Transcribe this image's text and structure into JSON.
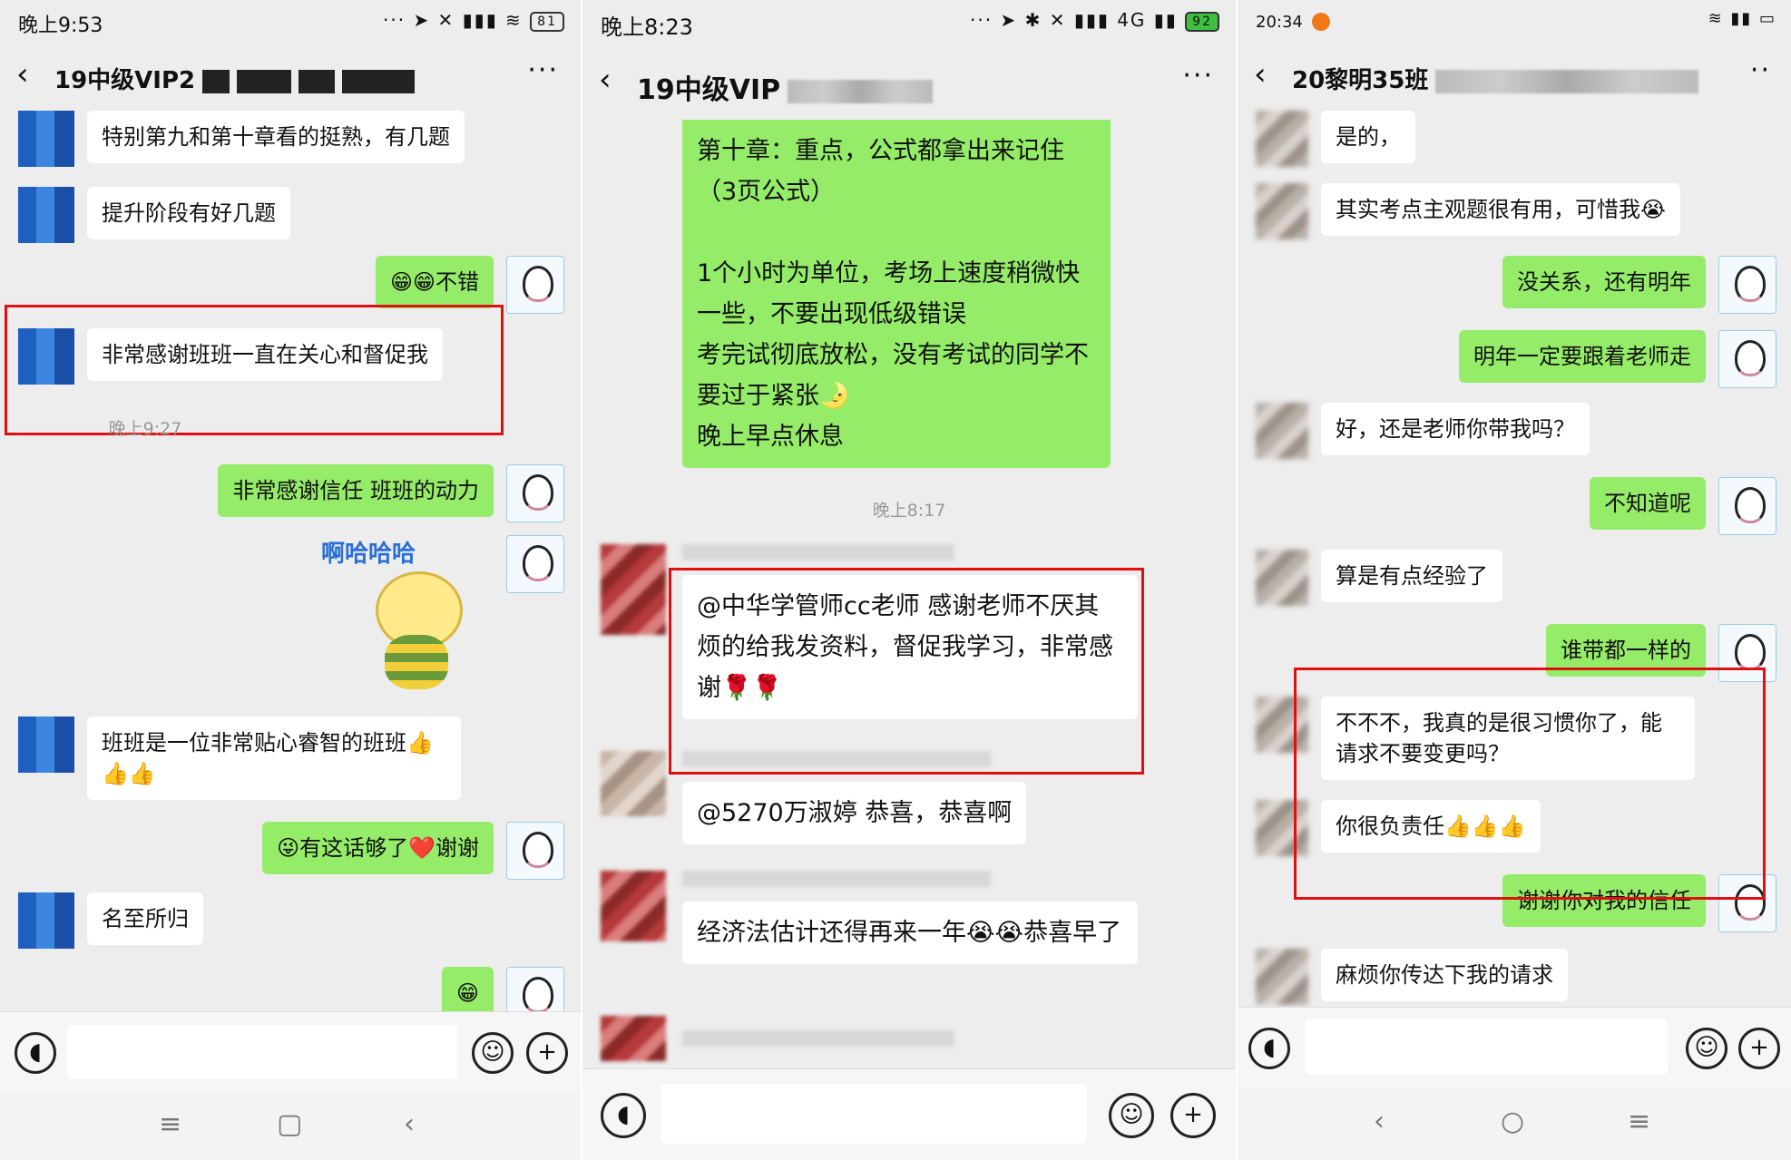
{
  "p1": {
    "status_time": "晚上9:53",
    "battery": "81",
    "title": "19中级VIP2",
    "messages": [
      "特别第九和第十章看的挺熟，有几题",
      "提升阶段有好几题",
      "😁😁不错",
      "非常感谢班班一直在关心和督促我",
      "非常感谢信任 班班的动力",
      "班班是一位非常贴心睿智的班班👍👍👍",
      "😜有这话够了❤️谢谢",
      "名至所归",
      "😁"
    ],
    "timestamp": "晚上9:27",
    "sticker_text": "啊哈哈哈"
  },
  "p2": {
    "status_time": "晚上8:23",
    "battery": "92",
    "network": "4G",
    "title": "19中级VIP",
    "top_message": "第十章：重点，公式都拿出来记住（3页公式）\n\n1个小时为单位，考场上速度稍微快一些，不要出现低级错误\n考完试彻底放松，没有考试的同学不要过于紧张🌛\n晚上早点休息",
    "timestamp": "晚上8:17",
    "messages": [
      "@中华学管师cc老师  感谢老师不厌其烦的给我发资料，督促我学习，非常感谢🌹🌹",
      "@5270万淑婷   恭喜，恭喜啊",
      "经济法估计还得再来一年😭😭恭喜早了"
    ]
  },
  "p3": {
    "status_time": "20:34",
    "title": "20黎明35班",
    "messages": [
      "是的，",
      "其实考点主观题很有用，可惜我😭",
      "没关系，还有明年",
      "明年一定要跟着老师走",
      "好，还是老师你带我吗？",
      "不知道呢",
      "算是有点经验了",
      "谁带都一样的",
      "不不不，我真的是很习惯你了，能请求不要变更吗？",
      "你很负责任👍👍👍",
      "谢谢你对我的信任",
      "麻烦你传达下我的请求"
    ]
  },
  "icons": {
    "back": "‹",
    "more": "···",
    "voice": "voice-icon",
    "emoji": "emoji-icon",
    "plus": "plus-icon"
  }
}
